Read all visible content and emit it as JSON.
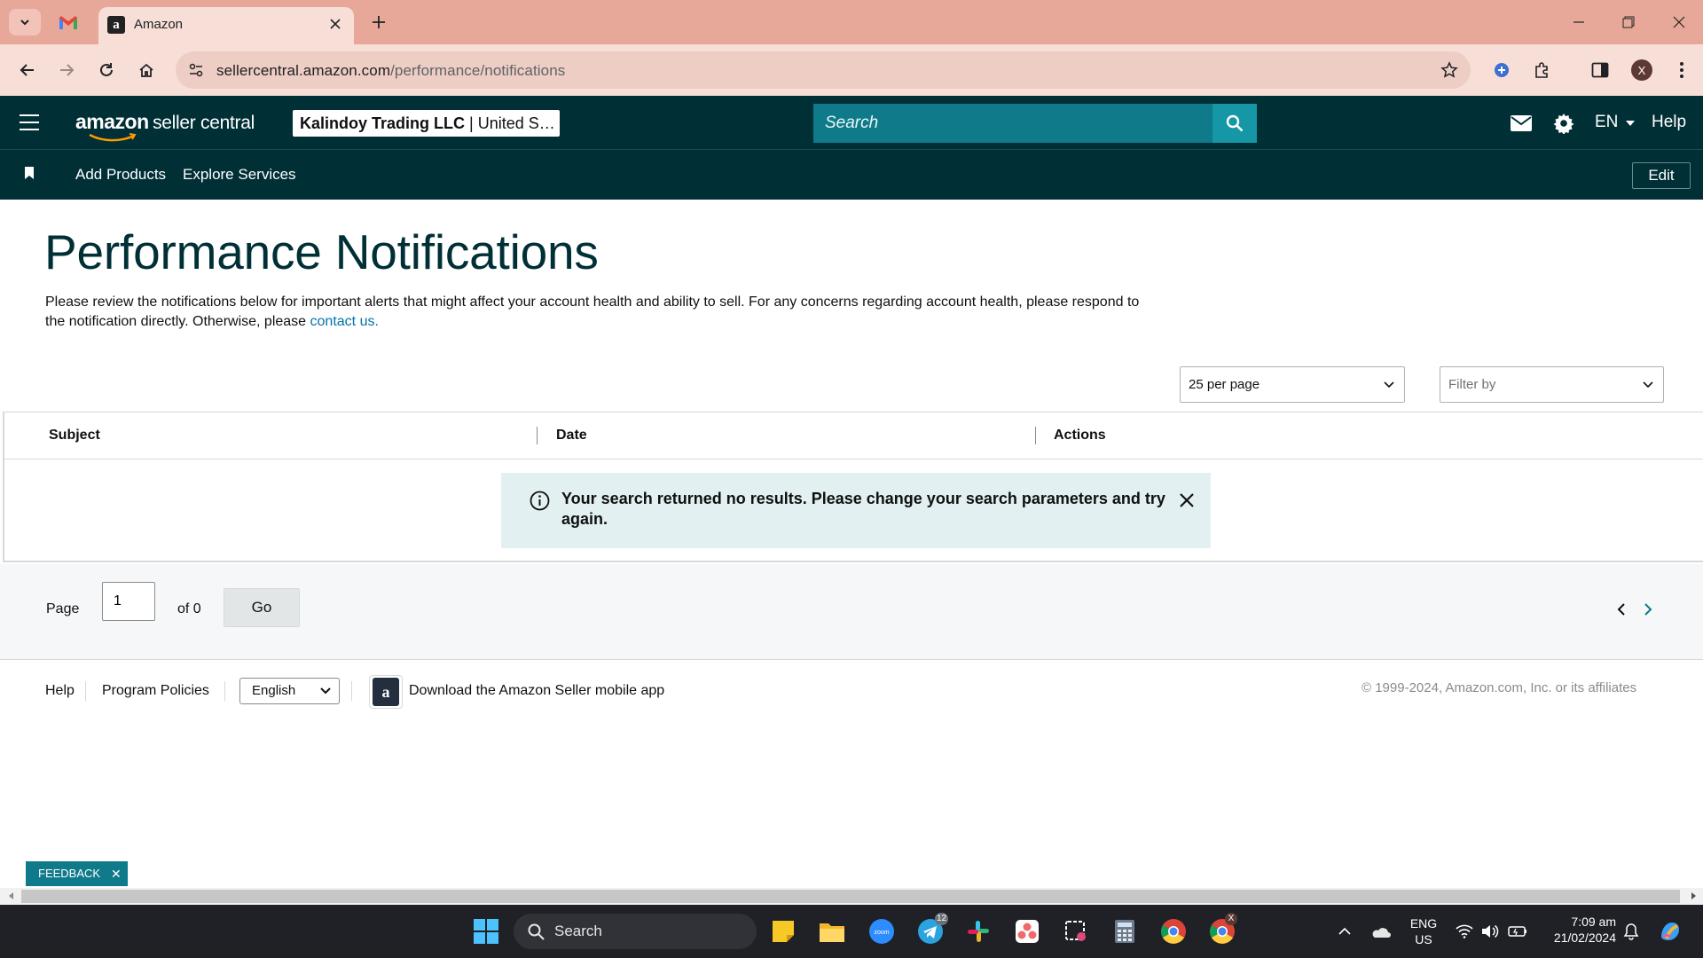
{
  "browser": {
    "tab_title": "Amazon",
    "url_domain": "sellercentral.amazon.com",
    "url_path": "/performance/notifications",
    "profile_initial": "X"
  },
  "header": {
    "logo_brand": "amazon",
    "logo_product": "seller central",
    "account_name": "Kalindoy Trading LLC",
    "account_region": "United S…",
    "search_placeholder": "Search",
    "language": "EN",
    "help_label": "Help"
  },
  "subnav": {
    "items": [
      "Add Products",
      "Explore Services"
    ],
    "edit_label": "Edit"
  },
  "page": {
    "title": "Performance Notifications",
    "description": "Please review the notifications below for important alerts that might affect your account health and ability to sell. For any concerns regarding account health, please respond to the notification directly. Otherwise, please",
    "contact_link": "contact us."
  },
  "filters": {
    "per_page": "25 per page",
    "filter_placeholder": "Filter by"
  },
  "table": {
    "columns": [
      "Subject",
      "Date",
      "Actions"
    ],
    "empty_message": "Your search returned no results. Please change your search parameters and try again."
  },
  "pagination": {
    "page_label": "Page",
    "page_value": "1",
    "of_label": "of 0",
    "go_label": "Go"
  },
  "footer": {
    "help": "Help",
    "program_policies": "Program Policies",
    "language": "English",
    "app_download": "Download the Amazon Seller mobile app",
    "copyright": "© 1999-2024, Amazon.com, Inc. or its affiliates"
  },
  "feedback_label": "FEEDBACK",
  "taskbar": {
    "search_label": "Search",
    "telegram_badge": "12",
    "chrome_badge": "X",
    "lang_top": "ENG",
    "lang_bottom": "US",
    "time": "7:09 am",
    "date": "21/02/2024"
  },
  "colors": {
    "header_bg": "#002f36",
    "accent_teal": "#0f7a89",
    "link": "#0073a8",
    "browser_frame": "#e8a899"
  }
}
